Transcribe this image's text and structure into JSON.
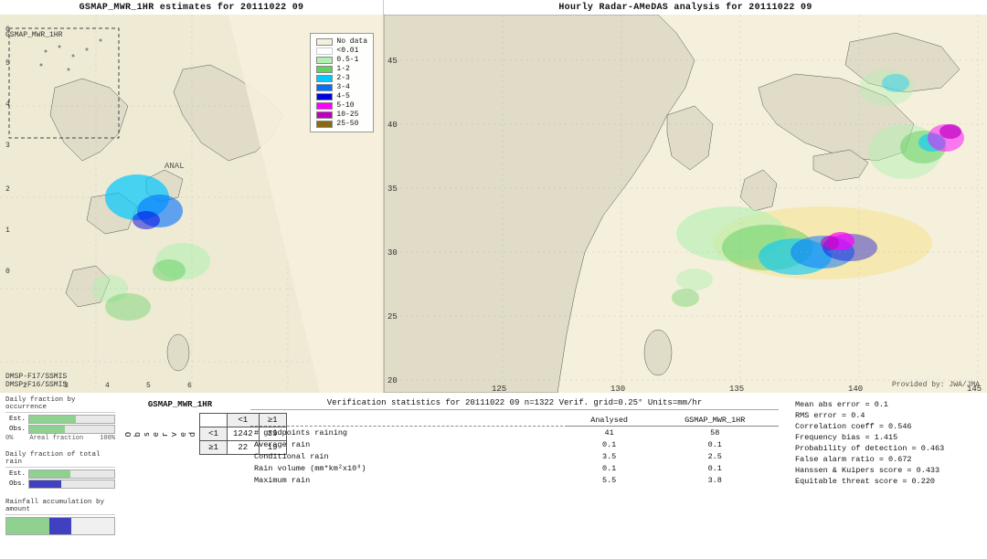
{
  "leftMap": {
    "title": "GSMAP_MWR_1HR estimates for 20111022 09",
    "gsmapLabel": "GSMAP_MWR_1HR",
    "dmspLabels": [
      "DMSP-F17/SSMIS",
      "DMSP-F16/SSMIS"
    ],
    "analLabel": "ANAL"
  },
  "rightMap": {
    "title": "Hourly Radar-AMeDAS analysis for 20111022 09",
    "providedBy": "Provided by: JWA/JMA",
    "latLabels": [
      "45",
      "40",
      "35",
      "30",
      "25",
      "20"
    ],
    "lonLabels": [
      "125",
      "130",
      "135",
      "140",
      "145"
    ]
  },
  "legend": {
    "title": "No data",
    "items": [
      {
        "label": "No data",
        "color": "#f5f0dc"
      },
      {
        "label": "<0.01",
        "color": "#ffffff"
      },
      {
        "label": "0.5-1",
        "color": "#b2f0b2"
      },
      {
        "label": "1-2",
        "color": "#60d060"
      },
      {
        "label": "2-3",
        "color": "#00c8ff"
      },
      {
        "label": "3-4",
        "color": "#0070ff"
      },
      {
        "label": "4-5",
        "color": "#0000e0"
      },
      {
        "label": "5-10",
        "color": "#ff00ff"
      },
      {
        "label": "10-25",
        "color": "#c000c0"
      },
      {
        "label": "25-50",
        "color": "#8b6914"
      }
    ]
  },
  "barCharts": {
    "section1": {
      "title": "Daily fraction by occurrence",
      "rows": [
        {
          "label": "Est.",
          "value": 0.55,
          "color": "#90d090"
        },
        {
          "label": "Obs.",
          "value": 0.42,
          "color": "#90d090"
        }
      ],
      "axisLabels": [
        "0%",
        "Areal fraction",
        "100%"
      ]
    },
    "section2": {
      "title": "Daily fraction of total rain",
      "rows": [
        {
          "label": "Est.",
          "value": 0.48,
          "color": "#90d090"
        },
        {
          "label": "Obs.",
          "value": 0.38,
          "color": "#4040c0"
        }
      ]
    },
    "section3": {
      "title": "Rainfall accumulation by amount"
    }
  },
  "contingencyTable": {
    "title": "GSMAP_MWR_1HR",
    "colHeaders": [
      "<1",
      "≥1"
    ],
    "rowHeaders": [
      "<1",
      "≥1"
    ],
    "obsLabel": "O b s e r v e d",
    "cells": [
      [
        1242,
        39
      ],
      [
        22,
        19
      ]
    ]
  },
  "verifStats": {
    "title": "Verification statistics for 20111022 09  n=1322  Verif. grid=0.25°  Units=mm/hr",
    "colHeaders": [
      "Analysed",
      "GSMAP_MWR_1HR"
    ],
    "rows": [
      {
        "label": "# gridpoints raining",
        "vals": [
          "41",
          "58"
        ]
      },
      {
        "label": "Average rain",
        "vals": [
          "0.1",
          "0.1"
        ]
      },
      {
        "label": "Conditional rain",
        "vals": [
          "3.5",
          "2.5"
        ]
      },
      {
        "label": "Rain volume (mm*km²x10⁸)",
        "vals": [
          "0.1",
          "0.1"
        ]
      },
      {
        "label": "Maximum rain",
        "vals": [
          "5.5",
          "3.8"
        ]
      }
    ]
  },
  "rightStats": {
    "lines": [
      "Mean abs error = 0.1",
      "RMS error = 0.4",
      "Correlation coeff = 0.546",
      "Frequency bias = 1.415",
      "Probability of detection = 0.463",
      "False alarm ratio = 0.672",
      "Hanssen & Kuipers score = 0.433",
      "Equitable threat score = 0.220"
    ]
  }
}
